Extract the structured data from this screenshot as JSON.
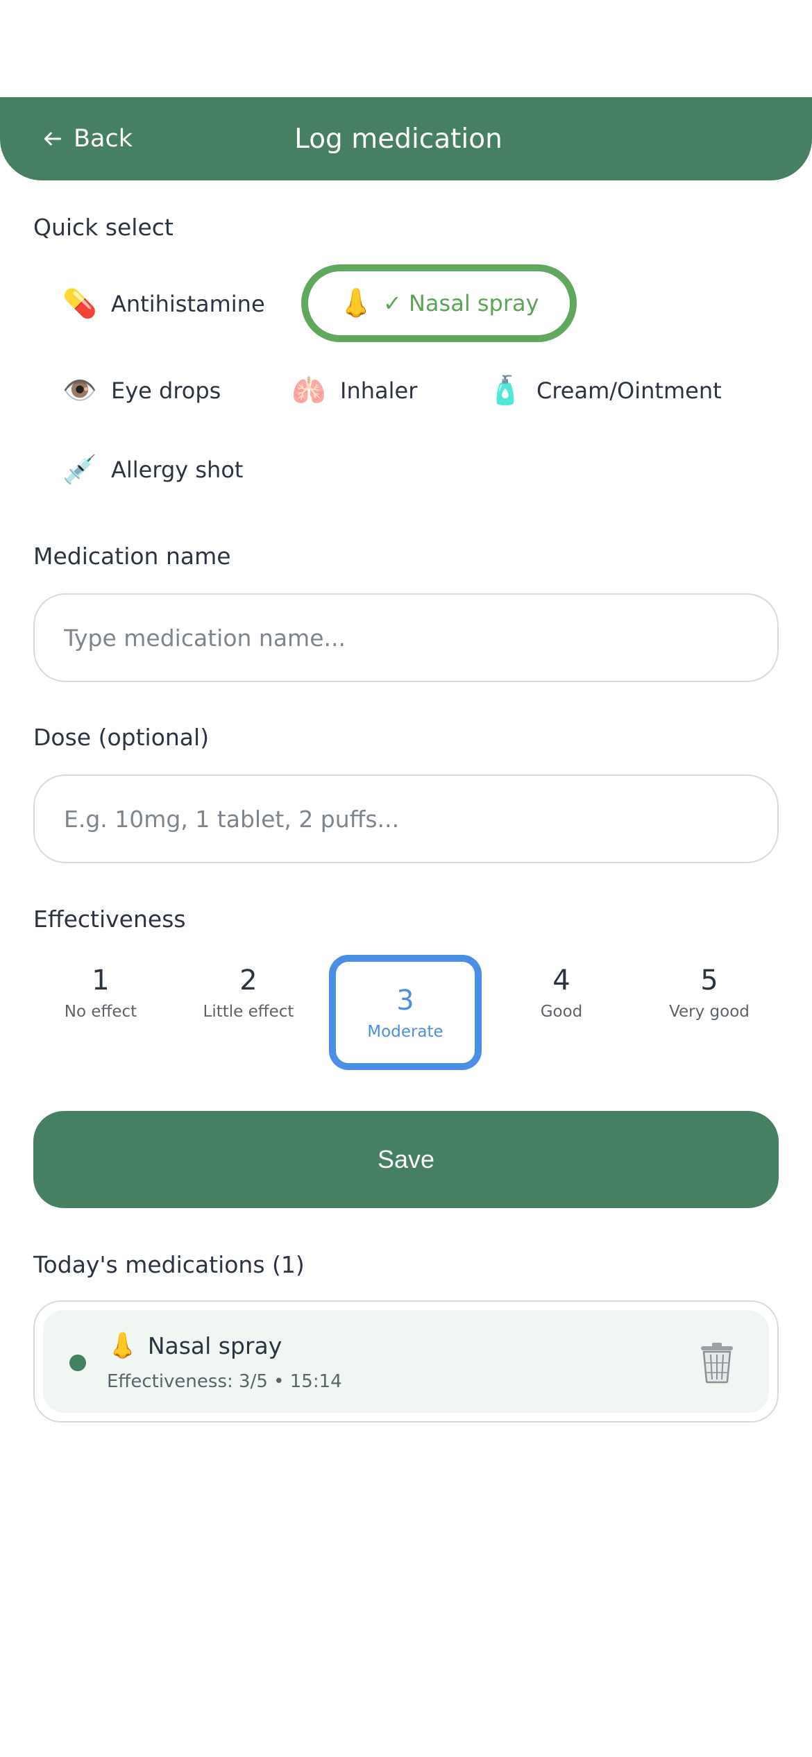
{
  "header": {
    "back_label": "Back",
    "title": "Log medication",
    "color": "#467f61"
  },
  "quick_select": {
    "label": "Quick select",
    "items": [
      {
        "emoji": "💊",
        "label": "Antihistamine",
        "selected": false
      },
      {
        "emoji": "👃",
        "label": "✓ Nasal spray",
        "selected": true
      },
      {
        "emoji": "👁️",
        "label": "Eye drops",
        "selected": false
      },
      {
        "emoji": "🫁",
        "label": "Inhaler",
        "selected": false
      },
      {
        "emoji": "🧴",
        "label": "Cream/Ointment",
        "selected": false
      },
      {
        "emoji": "💉",
        "label": "Allergy shot",
        "selected": false
      }
    ],
    "selected_color": "#5fa85d"
  },
  "medication_name": {
    "label": "Medication name",
    "value": "",
    "placeholder": "Type medication name..."
  },
  "dose": {
    "label": "Dose (optional)",
    "value": "",
    "placeholder": "E.g. 10mg, 1 tablet, 2 puffs..."
  },
  "effectiveness": {
    "label": "Effectiveness",
    "options": [
      {
        "value": "1",
        "label": "No effect"
      },
      {
        "value": "2",
        "label": "Little effect"
      },
      {
        "value": "3",
        "label": "Moderate"
      },
      {
        "value": "4",
        "label": "Good"
      },
      {
        "value": "5",
        "label": "Very good"
      }
    ],
    "selected": 3,
    "selected_color": "#4a8fe4"
  },
  "save_label": "Save",
  "today": {
    "label": "Today's medications (1)",
    "items": [
      {
        "emoji": "👃",
        "name": "Nasal spray",
        "meta": "Effectiveness: 3/5 • 15:14"
      }
    ]
  }
}
